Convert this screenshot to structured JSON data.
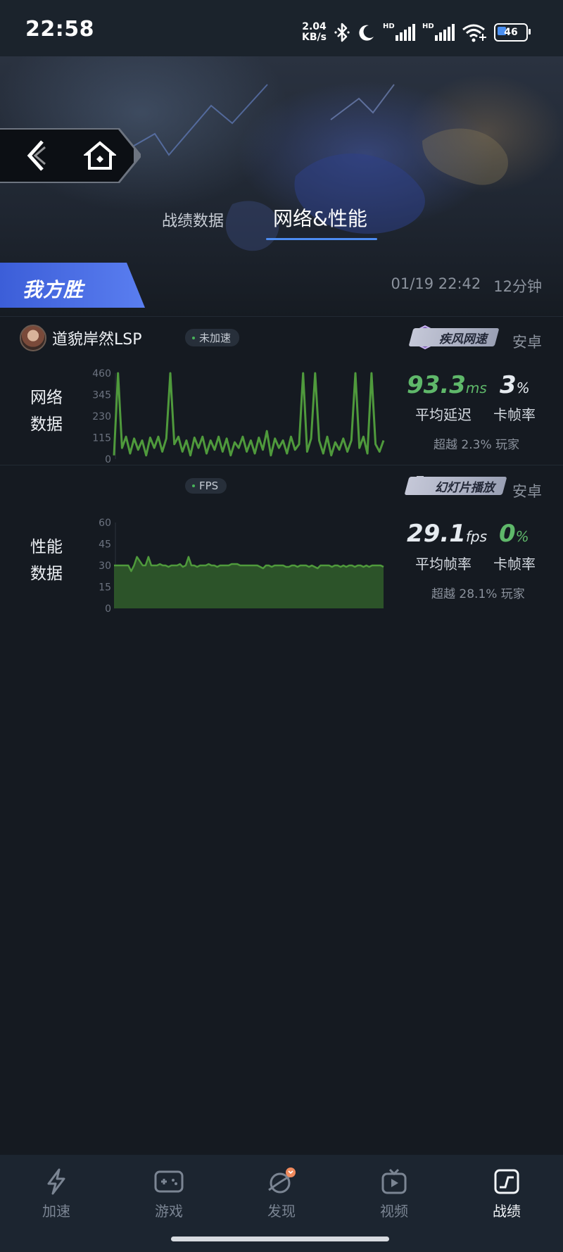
{
  "status_bar": {
    "time": "22:58",
    "net_speed_value": "2.04",
    "net_speed_unit": "KB/s",
    "signal1_tag": "HD",
    "signal2_tag": "HD",
    "battery": "46",
    "icons": [
      "bluetooth-icon",
      "moon-icon",
      "signal-icon",
      "signal-icon",
      "wifi-icon",
      "battery-icon"
    ]
  },
  "header": {
    "tabs": [
      {
        "label": "战绩数据",
        "active": false
      },
      {
        "label": "网络&性能",
        "active": true
      }
    ],
    "result": "我方胜",
    "match_time": "01/19 22:42",
    "duration": "12分钟"
  },
  "player": {
    "name": "道貌岸然LSP",
    "speed_status": "未加速",
    "network_badge": "疾风网速",
    "platform": "安卓",
    "perf_badge": "幻灯片播放",
    "fps_pill": "FPS"
  },
  "network": {
    "label_line1": "网络",
    "label_line2": "数据",
    "avg_latency": "93.3",
    "avg_latency_unit": "ms",
    "stutter_rate": "3",
    "stutter_unit": "%",
    "avg_latency_label": "平均延迟",
    "stutter_label": "卡帧率",
    "beat_text": "超越 2.3% 玩家"
  },
  "performance": {
    "label_line1": "性能",
    "label_line2": "数据",
    "avg_fps": "29.1",
    "avg_fps_unit": "fps",
    "stutter_rate": "0",
    "stutter_unit": "%",
    "avg_fps_label": "平均帧率",
    "stutter_label": "卡帧率",
    "beat_text": "超越 28.1% 玩家"
  },
  "bottom_nav": [
    {
      "label": "加速",
      "icon": "lightning-icon",
      "active": false
    },
    {
      "label": "游戏",
      "icon": "gamepad-icon",
      "active": false
    },
    {
      "label": "发现",
      "icon": "planet-icon",
      "active": false
    },
    {
      "label": "视频",
      "icon": "tv-icon",
      "active": false
    },
    {
      "label": "战绩",
      "icon": "chart-icon",
      "active": true
    }
  ],
  "colors": {
    "accent": "#4d8cf0",
    "good_green": "#5fb86a",
    "chart_green": "#4f9a3c",
    "background": "#151a21"
  },
  "chart_data": [
    {
      "type": "line",
      "yticks": [
        0,
        115,
        230,
        345,
        460
      ],
      "ylim": [
        0,
        460
      ],
      "series": [
        {
          "values": [
            20,
            460,
            60,
            120,
            30,
            110,
            50,
            100,
            20,
            115,
            60,
            120,
            40,
            110,
            460,
            80,
            120,
            40,
            100,
            20,
            115,
            60,
            120,
            30,
            100,
            50,
            120,
            40,
            110,
            20,
            90,
            60,
            120,
            40,
            100,
            30,
            115,
            50,
            150,
            20,
            110,
            60,
            100,
            30,
            120,
            50,
            80,
            460,
            40,
            110,
            460,
            100,
            30,
            120,
            20,
            90,
            50,
            110,
            40,
            100,
            460,
            60,
            120,
            30,
            460,
            80,
            40,
            100
          ]
        }
      ]
    },
    {
      "type": "area",
      "yticks": [
        0,
        15,
        30,
        45,
        60
      ],
      "ylim": [
        0,
        60
      ],
      "series": [
        {
          "values": [
            30,
            30,
            30,
            30,
            30,
            30,
            26,
            30,
            36,
            33,
            30,
            30,
            36,
            30,
            30,
            30,
            31,
            30,
            30,
            29,
            30,
            30,
            30,
            31,
            29,
            30,
            36,
            30,
            30,
            29,
            30,
            30,
            30,
            31,
            30,
            30,
            29,
            30,
            30,
            30,
            30,
            31,
            31,
            31,
            30,
            30,
            30,
            30,
            30,
            30,
            30,
            29,
            28,
            30,
            30,
            29,
            30,
            30,
            30,
            30,
            29,
            29,
            30,
            30,
            29,
            30,
            30,
            30,
            29,
            30,
            29,
            28,
            30,
            30,
            30,
            30,
            29,
            30,
            30,
            29,
            30,
            29,
            30,
            30,
            29,
            30,
            30,
            29,
            30,
            29,
            30,
            30,
            30,
            30,
            29
          ]
        }
      ]
    }
  ]
}
